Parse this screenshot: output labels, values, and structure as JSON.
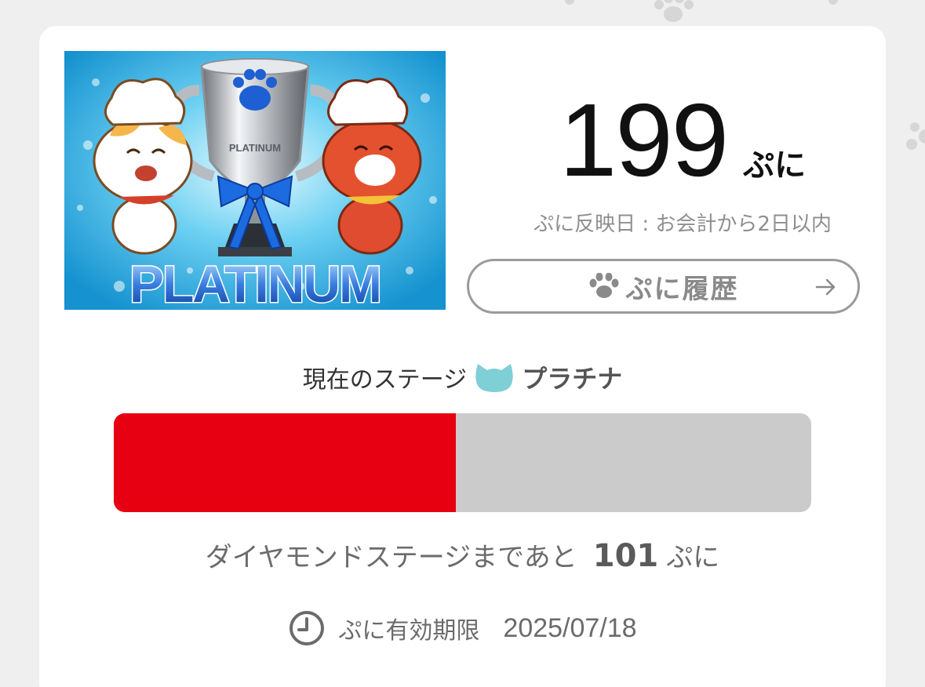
{
  "banner": {
    "alt": "PLATINUM",
    "trophy_text": "PLATINUM",
    "headline": "PLATINUM"
  },
  "points": {
    "value": "199",
    "unit": "ぷに",
    "reflect_note": "ぷに反映日 : お会計から2日以内"
  },
  "history_button": {
    "label": "ぷに履歴",
    "icon": "paw-icon",
    "arrow_icon": "arrow-right-icon"
  },
  "stage": {
    "prefix": "現在のステージ",
    "name": "プラチナ",
    "icon": "cat-face-icon",
    "icon_color": "#7ecfd6"
  },
  "progress": {
    "fraction": 0.49,
    "fill_color": "#e60012",
    "track_color": "#cbcbcb"
  },
  "next_stage": {
    "text": "ダイヤモンドステージまであと",
    "remaining": "101",
    "unit": "ぷに"
  },
  "expiry": {
    "icon": "clock-icon",
    "label": "ぷに有効期限",
    "date": "2025/07/18"
  }
}
